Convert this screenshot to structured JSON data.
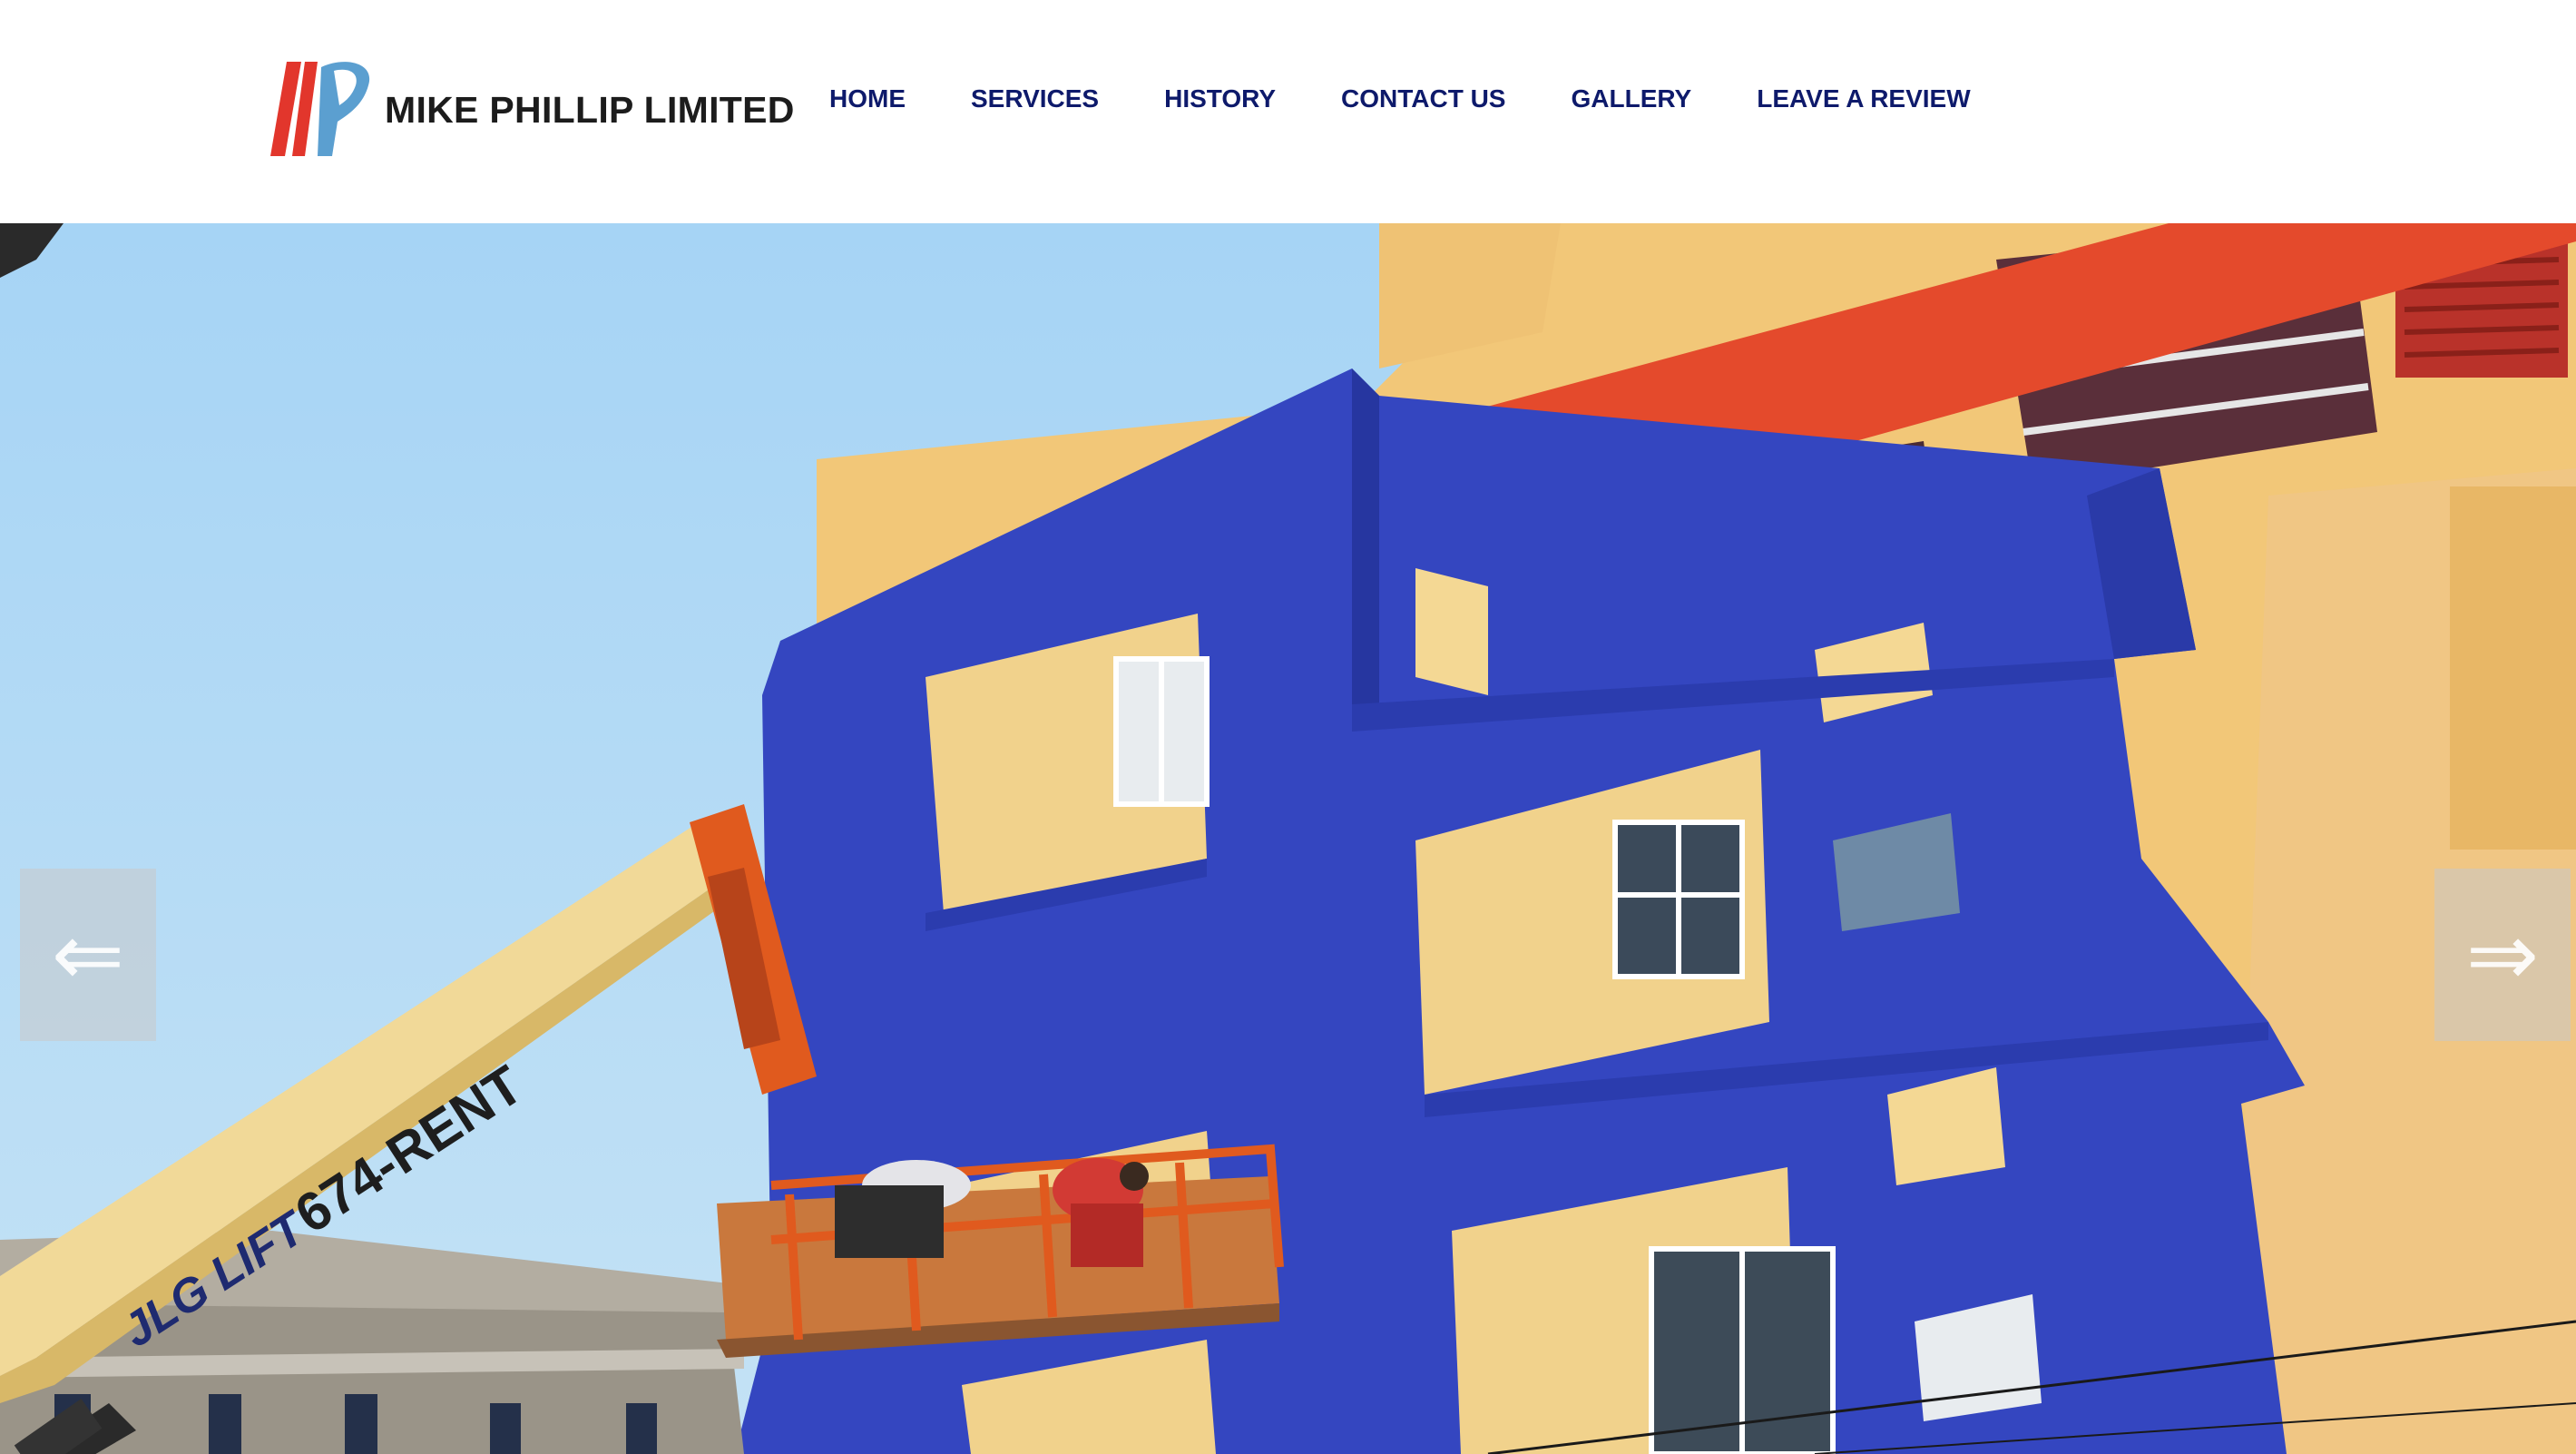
{
  "brand": {
    "name": "MIKE PHILLIP LIMITED",
    "logo_colors": {
      "red": "#e2362c",
      "blue": "#5b9fd0"
    }
  },
  "nav": {
    "items": [
      {
        "label": "HOME"
      },
      {
        "label": "SERVICES"
      },
      {
        "label": "HISTORY"
      },
      {
        "label": "CONTACT US"
      },
      {
        "label": "GALLERY"
      },
      {
        "label": "LEAVE A REVIEW"
      }
    ],
    "text_color": "#0e1a6b"
  },
  "hero": {
    "image_texts": {
      "lift_brand": "JLG LIFT",
      "lift_phone": "674-RENT"
    },
    "prev_icon": "arrow-left-icon",
    "next_icon": "arrow-right-icon",
    "prev_glyph": "⇐",
    "next_glyph": "⇒",
    "colors": {
      "sky": "#a9d6f4",
      "wall_blue": "#3446c0",
      "wall_yellow": "#f2c778",
      "roof_red": "#e44a2c",
      "lift_orange": "#e05a1e"
    }
  }
}
